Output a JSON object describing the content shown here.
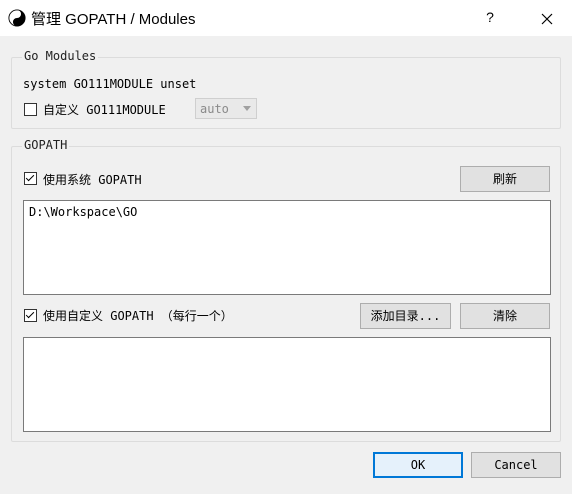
{
  "window": {
    "title": "管理 GOPATH / Modules",
    "help_label": "?",
    "close_label": "✕"
  },
  "modules": {
    "group_label": "Go Modules",
    "status_text": "system GO111MODULE unset",
    "custom_checkbox_label": "自定义 GO111MODULE",
    "custom_checked": false,
    "mode_value": "auto"
  },
  "gopath": {
    "group_label": "GOPATH",
    "system_checkbox_label": "使用系统 GOPATH",
    "system_checked": true,
    "refresh_label": "刷新",
    "system_paths": "D:\\Workspace\\GO",
    "custom_checkbox_label": "使用自定义 GOPATH （每行一个）",
    "custom_checked": true,
    "add_dir_label": "添加目录...",
    "clear_label": "清除",
    "custom_paths": ""
  },
  "footer": {
    "ok_label": "OK",
    "cancel_label": "Cancel"
  }
}
